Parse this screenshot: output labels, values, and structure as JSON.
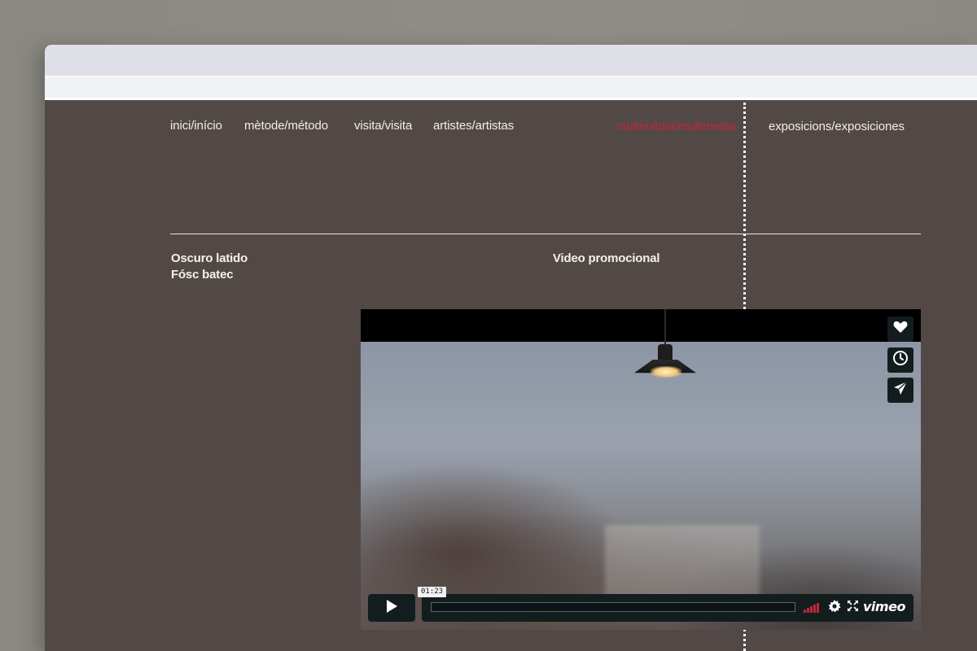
{
  "nav": {
    "items": [
      {
        "label": "inici/início"
      },
      {
        "label": "mètode/método"
      },
      {
        "label": "visita/visita"
      },
      {
        "label": "artistes/artistas"
      },
      {
        "label": "multimèdia/multimedia",
        "active": true
      },
      {
        "label": "exposicions/exposiciones"
      }
    ]
  },
  "section": {
    "title_line1": "Oscuro latido",
    "title_line2": "Fósc batec",
    "video_title": "Video promocional"
  },
  "player": {
    "timecode": "01:23",
    "progress_fraction": 0.0,
    "logo": "vimeo",
    "side_buttons": [
      "heart-icon",
      "clock-icon",
      "paper-plane-icon"
    ],
    "volume_level": "full"
  },
  "colors": {
    "accent": "#c1273a",
    "background": "#524947",
    "player_controls": "#141d1e"
  }
}
